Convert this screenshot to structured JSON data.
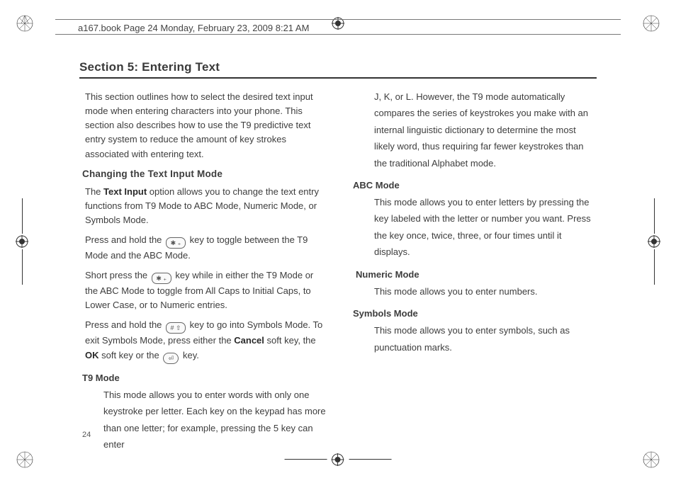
{
  "meta": {
    "header": "a167.book  Page 24  Monday, February 23, 2009  8:21 AM",
    "page_number": "24"
  },
  "section_title": "Section 5: Entering Text",
  "intro": "This section outlines how to select the desired text input mode when entering characters into your phone. This section also describes how to use the T9 predictive text entry system to reduce the amount of key strokes associated with entering text.",
  "h2": "Changing the Text Input Mode",
  "p1a": "The ",
  "p1b": "Text Input",
  "p1c": " option allows you to change the text entry functions from T9 Mode to ABC Mode, Numeric Mode, or Symbols Mode.",
  "p2a": "Press and hold the ",
  "p2b": " key to toggle between the T9 Mode and the ABC Mode.",
  "p3a": "Short press the ",
  "p3b": " key while in either the T9 Mode or the ABC Mode to toggle from All Caps to Initial Caps, to Lower Case, or to Numeric entries.",
  "p4a": "Press and hold the ",
  "p4b": " key to go into Symbols Mode. To exit Symbols Mode, press either the ",
  "p4c": "Cancel",
  "p4d": " soft key, the ",
  "p4e": "OK",
  "p4f": " soft key or the ",
  "p4g": " key.",
  "t9_label": "T9 Mode",
  "t9_body_1": "This mode allows you to enter words with only one keystroke per letter. Each key on the keypad has more than one letter; for example, pressing the 5 key can enter",
  "t9_body_2": "J, K, or L. However, the T9 mode automatically compares the series of keystrokes you make with an internal linguistic dictionary to determine the most likely word, thus requiring far fewer keystrokes than the traditional Alphabet mode.",
  "abc_label": "ABC Mode",
  "abc_body": "This mode allows you to enter letters by pressing the key labeled with the letter or number you want. Press the key once, twice, three, or four times until it displays.",
  "num_label": "Numeric Mode",
  "num_body": "This mode allows you to enter numbers.",
  "sym_label": "Symbols Mode",
  "sym_body": "This mode allows you to enter symbols, such as punctuation marks.",
  "icons": {
    "star_key": "✱ ₊",
    "hash_key": "# ⇧",
    "round_key": "⏎"
  }
}
